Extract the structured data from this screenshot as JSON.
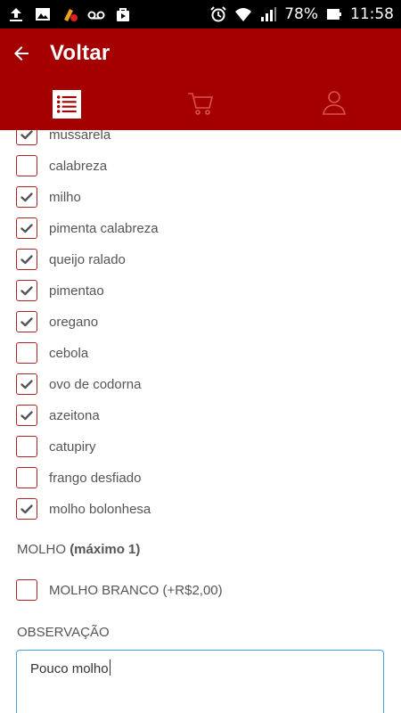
{
  "status_bar": {
    "battery": "78%",
    "time": "11:58",
    "left_icons": [
      "upload-icon",
      "image-icon",
      "brush-notify-icon",
      "voicemail-icon",
      "bag-icon"
    ],
    "right_icons": [
      "alarm-icon",
      "wifi-icon",
      "signal-icon",
      "battery-icon"
    ]
  },
  "header": {
    "back_icon": "arrow-left-icon",
    "title": "Voltar",
    "color": "#a40000"
  },
  "tabs": [
    {
      "icon": "list-icon",
      "selected": true
    },
    {
      "icon": "cart-icon",
      "selected": false
    },
    {
      "icon": "user-icon",
      "selected": false
    }
  ],
  "ingredients": [
    {
      "label": "mussarela",
      "checked": true
    },
    {
      "label": "calabreza",
      "checked": false
    },
    {
      "label": "milho",
      "checked": true
    },
    {
      "label": "pimenta calabreza",
      "checked": true
    },
    {
      "label": "queijo ralado",
      "checked": true
    },
    {
      "label": "pimentao",
      "checked": true
    },
    {
      "label": "oregano",
      "checked": true
    },
    {
      "label": "cebola",
      "checked": false
    },
    {
      "label": "ovo de codorna",
      "checked": true
    },
    {
      "label": "azeitona",
      "checked": true
    },
    {
      "label": "catupiry",
      "checked": false
    },
    {
      "label": "frango desfiado",
      "checked": false
    },
    {
      "label": "molho bolonhesa",
      "checked": true
    }
  ],
  "molho": {
    "title": "MOLHO",
    "limit": "(máximo 1)",
    "options": [
      {
        "label": "MOLHO BRANCO (+R$2,00)",
        "checked": false
      }
    ]
  },
  "observacao": {
    "title": "OBSERVAÇÃO",
    "value": "Pouco molho"
  },
  "colors": {
    "accent": "#a40000",
    "checkbox_border": "#b22222",
    "focus_border": "#4aa0e0"
  }
}
